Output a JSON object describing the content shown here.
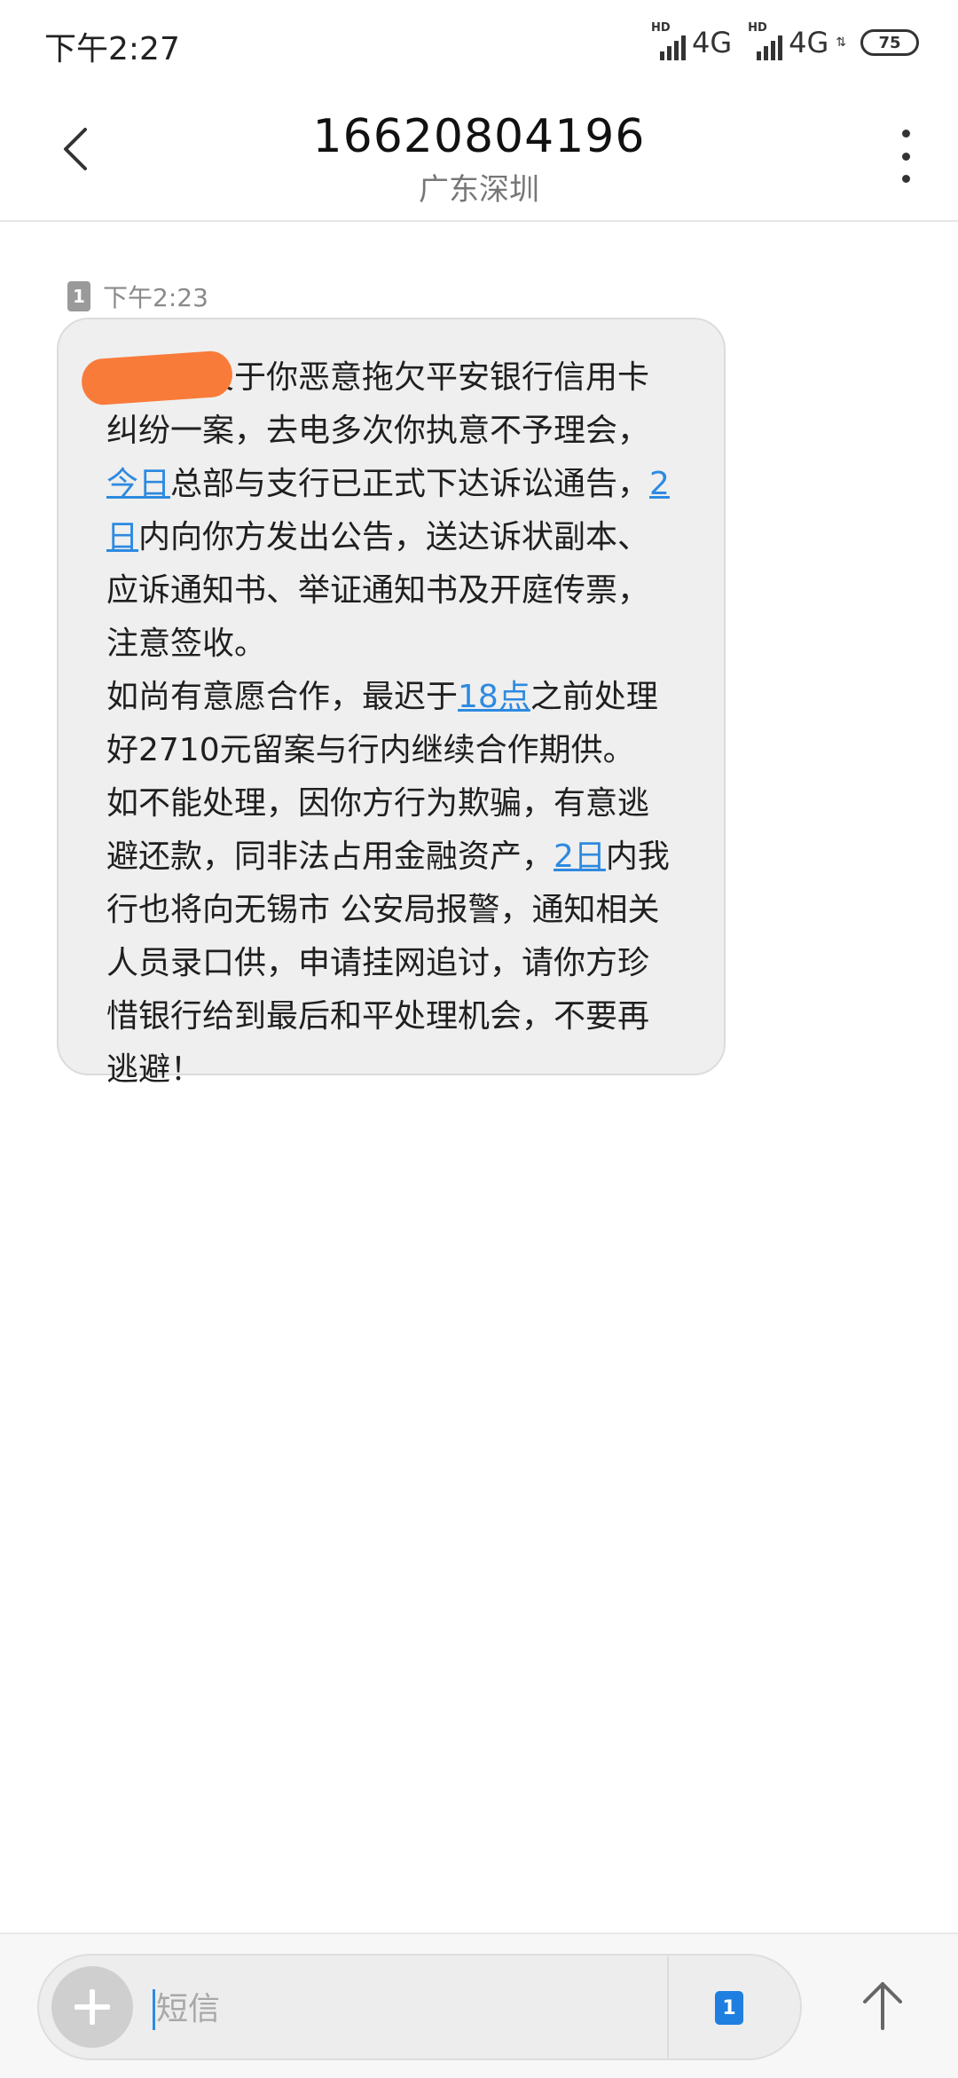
{
  "status_bar": {
    "time": "下午2:27",
    "signal1_hd": "HD",
    "signal1_network": "4G",
    "signal2_hd": "HD",
    "signal2_network": "4G",
    "battery": "75"
  },
  "header": {
    "title": "16620804196",
    "subtitle": "广东深圳"
  },
  "message": {
    "sim_slot": "1",
    "timestamp": "下午2:23",
    "segments": [
      {
        "text": "某某，关于你恶意拖欠平安银行信用卡纠纷一案，去电多次你执意不予理会，",
        "link": false
      },
      {
        "text": "今日",
        "link": true
      },
      {
        "text": "总部与支行已正式下达诉讼通告，",
        "link": false
      },
      {
        "text": "2日",
        "link": true
      },
      {
        "text": "内向你方发出公告，送达诉状副本、应诉通知书、举证通知书及开庭传票，注意签收。\n如尚有意愿合作，最迟于",
        "link": false
      },
      {
        "text": "18点",
        "link": true
      },
      {
        "text": "之前处理好2710元留案与行内继续合作期供。\n如不能处理，因你方行为欺骗，有意逃避还款，同非法占用金融资产，",
        "link": false
      },
      {
        "text": "2日",
        "link": true
      },
      {
        "text": "内我行也将向无锡市 公安局报警，通知相关人员录口供，申请挂网追讨，请你方珍惜银行给到最后和平处理机会，不要再逃避！",
        "link": false
      }
    ],
    "link_color": "#2e8ae0"
  },
  "composer": {
    "placeholder": "短信",
    "value": "",
    "sim_slot": "1",
    "accent": "#1e7fe0"
  },
  "icons": {
    "back": "chevron-left-icon",
    "more": "more-vertical-icon",
    "add": "plus-icon",
    "send": "arrow-up-icon"
  }
}
